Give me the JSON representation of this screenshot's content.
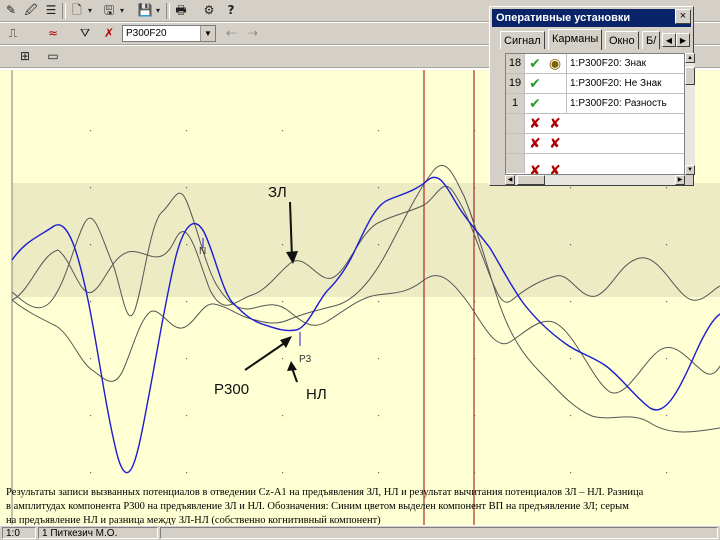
{
  "toolbar": {
    "combo_value": "P300F20"
  },
  "panel": {
    "title": "Оперативные установки",
    "close": "×",
    "tabs": [
      {
        "label": "Сигнал",
        "active": false
      },
      {
        "label": "Карманы",
        "active": true
      },
      {
        "label": "Окно",
        "active": false
      },
      {
        "label": "Б/",
        "active": false
      }
    ],
    "rows": [
      {
        "num": "18",
        "text": "1:P300F20: Знак"
      },
      {
        "num": "19",
        "text": "1:P300F20: Не Знак"
      },
      {
        "num": "1",
        "text": "1:P300F20: Разность"
      },
      {
        "num": "",
        "text": ""
      },
      {
        "num": "",
        "text": ""
      }
    ]
  },
  "plot": {
    "labels": {
      "zl": "ЗЛ",
      "p300": "P300",
      "nl": "НЛ",
      "p3": "P3",
      "n_mark": "N"
    },
    "colors": {
      "background": "#ffffd4",
      "band": "#ecebc4",
      "cursor": "#a00000",
      "gray_trace": "#505050",
      "blue_trace": "#1c1cd0"
    }
  },
  "caption": {
    "line1": "Результаты записи вызванных потенциалов в отведении Cz-A1 на предъявления ЗЛ, НЛ и результат вычитания потенциалов ЗЛ – НЛ. Разница",
    "line2": "в амплитудах компонента P300 на предъявление ЗЛ и НЛ. Обозначения: Синим цветом выделен компонент ВП на предъявление ЗЛ; серым",
    "line3": "на предъявление НЛ и разница между ЗЛ-НЛ (собственно когнитивный компонент)"
  },
  "status": {
    "left": "1:0",
    "patient": "1 Питкезич М.О."
  }
}
